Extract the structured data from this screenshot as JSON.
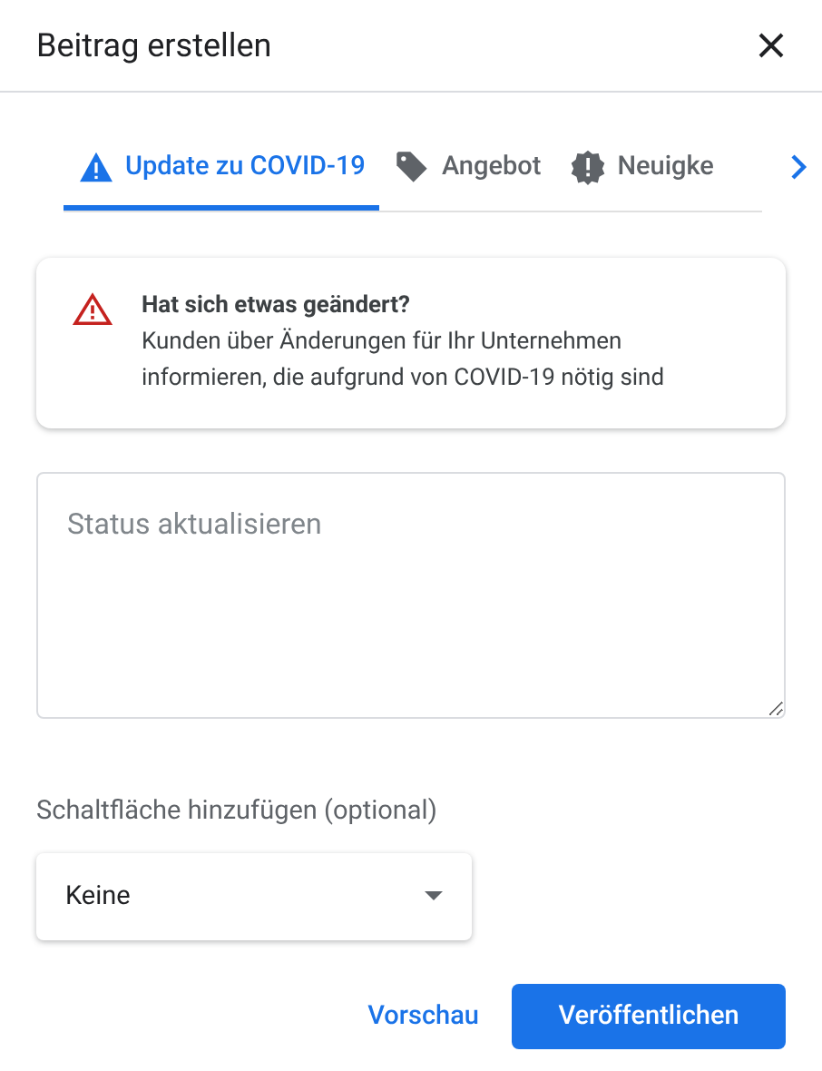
{
  "dialog": {
    "title": "Beitrag erstellen"
  },
  "tabs": [
    {
      "label": "Update zu COVID-19",
      "kind": "warning",
      "selected": true
    },
    {
      "label": "Angebot",
      "kind": "tag",
      "selected": false
    },
    {
      "label": "Neuigke",
      "kind": "alert",
      "selected": false
    }
  ],
  "notice": {
    "title": "Hat sich etwas geändert?",
    "text": "Kunden über Änderungen für Ihr Unternehmen informieren, die aufgrund von COVID-19 nötig sind"
  },
  "status_field": {
    "placeholder": "Status aktualisieren"
  },
  "button_select": {
    "label": "Schaltfläche hinzufügen (optional)",
    "value": "Keine"
  },
  "actions": [
    {
      "label": "Vorschau",
      "kind": "text"
    },
    {
      "label": "Veröffentlichen",
      "kind": "primary"
    }
  ]
}
